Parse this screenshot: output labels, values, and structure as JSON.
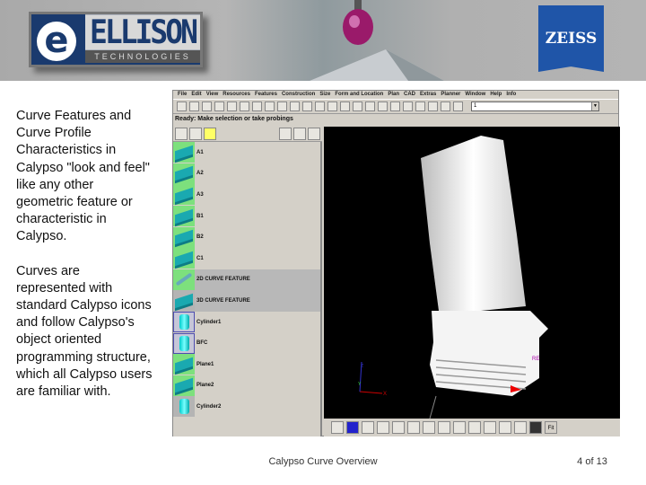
{
  "header": {
    "ellison_logo": {
      "letter": "e",
      "name": "ELLISON",
      "sub": "TECHNOLOGIES"
    },
    "zeiss_logo": "ZEISS"
  },
  "body_text": [
    "Curve Features and Curve Profile Characteristics in Calypso \"look and feel\" like any other geometric feature or characteristic in Calypso.",
    "Curves are represented with standard Calypso icons and follow Calypso's object oriented programming structure, which all Calypso users are familiar with."
  ],
  "app": {
    "menu": [
      "File",
      "Edit",
      "View",
      "Resources",
      "Features",
      "Construction",
      "Size",
      "Form and Location",
      "Plan",
      "CAD",
      "Extras",
      "Planner",
      "Window",
      "Help",
      "Info"
    ],
    "combo_value": "1",
    "status": "Ready: Make selection or take probings",
    "tree": [
      {
        "label": "A1",
        "icon": "plane-point-icon"
      },
      {
        "label": "A2",
        "icon": "plane-point-icon"
      },
      {
        "label": "A3",
        "icon": "plane-point-icon"
      },
      {
        "label": "B1",
        "icon": "plane-point-icon"
      },
      {
        "label": "B2",
        "icon": "plane-point-icon"
      },
      {
        "label": "C1",
        "icon": "plane-point-icon"
      },
      {
        "label": "2D CURVE FEATURE",
        "icon": "2d-curve-icon",
        "selected": true
      },
      {
        "label": "3D CURVE FEATURE",
        "icon": "3d-curve-icon",
        "selected": true
      },
      {
        "label": "Cylinder1",
        "icon": "cylinder-icon"
      },
      {
        "label": "BFC",
        "icon": "cylinder-icon"
      },
      {
        "label": "Plane1",
        "icon": "plane-icon"
      },
      {
        "label": "Plane2",
        "icon": "plane-icon"
      },
      {
        "label": "Cylinder2",
        "icon": "cylinder-icon"
      }
    ],
    "viewport": {
      "axis_x": "X",
      "axis_y": "Y",
      "axis_z": "Z",
      "marker": "RE"
    },
    "fit_label": "Fit"
  },
  "footer": {
    "title": "Calypso Curve Overview",
    "page": "4 of 13"
  },
  "colors": {
    "zeiss_blue": "#1f55a8",
    "ellison_navy": "#1a3a6e",
    "feature_green": "#7de07d",
    "viewport_bg": "#000000"
  }
}
